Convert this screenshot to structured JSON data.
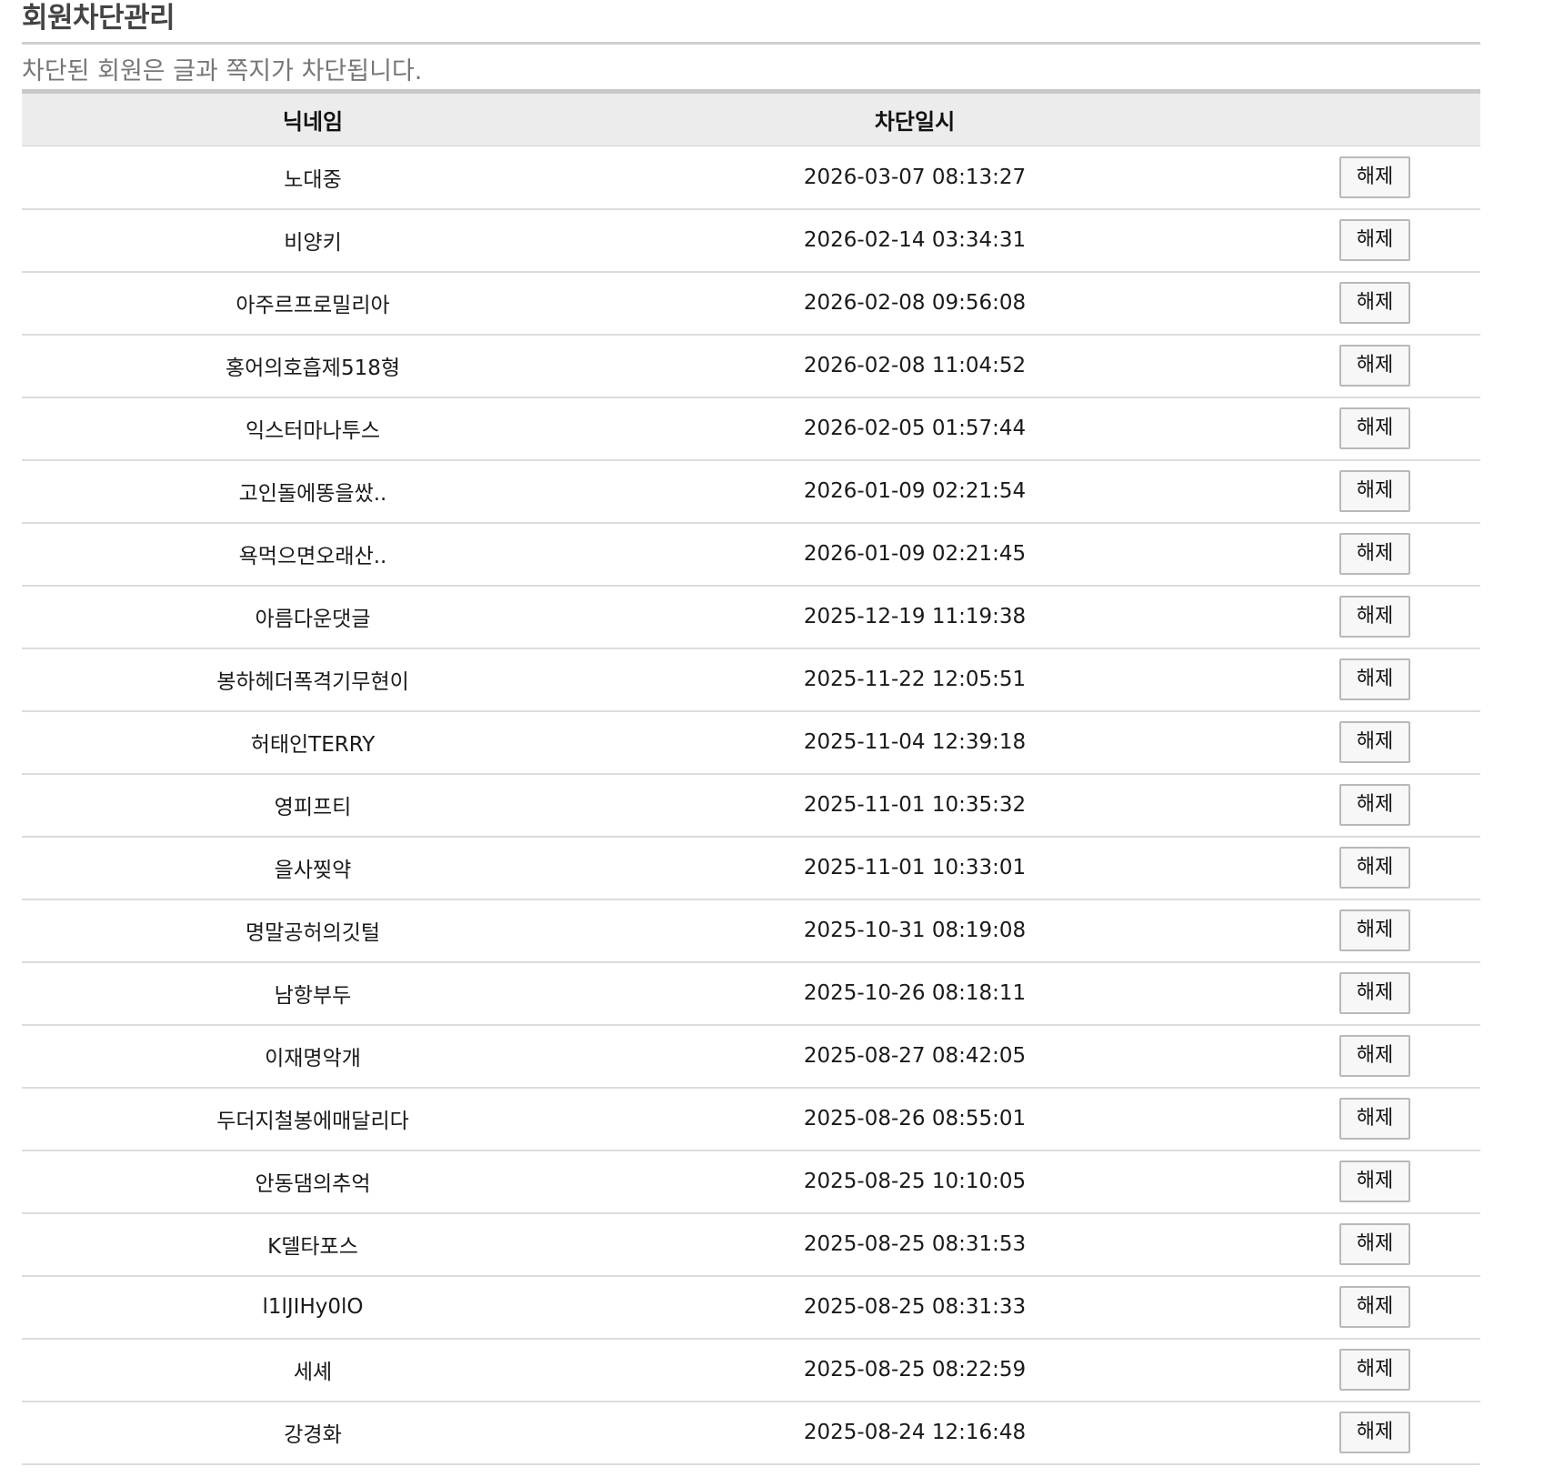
{
  "page": {
    "title": "회원차단관리",
    "notice": "차단된 회원은 글과 쪽지가 차단됩니다."
  },
  "table": {
    "columns": [
      "닉네임",
      "차단일시",
      ""
    ],
    "action_label": "해제",
    "rows": [
      {
        "nickname": "노대중",
        "blocked_at": "2026-03-07 08:13:27"
      },
      {
        "nickname": "비양키",
        "blocked_at": "2026-02-14 03:34:31"
      },
      {
        "nickname": "아주르프로밀리아",
        "blocked_at": "2026-02-08 09:56:08"
      },
      {
        "nickname": "홍어의호흡제518형",
        "blocked_at": "2026-02-08 11:04:52"
      },
      {
        "nickname": "익스터마나투스",
        "blocked_at": "2026-02-05 01:57:44"
      },
      {
        "nickname": "고인돌에똥을쌌..",
        "blocked_at": "2026-01-09 02:21:54"
      },
      {
        "nickname": "욕먹으면오래산..",
        "blocked_at": "2026-01-09 02:21:45"
      },
      {
        "nickname": "아름다운댓글",
        "blocked_at": "2025-12-19 11:19:38"
      },
      {
        "nickname": "봉하헤더폭격기무현이",
        "blocked_at": "2025-11-22 12:05:51"
      },
      {
        "nickname": "허태인TERRY",
        "blocked_at": "2025-11-04 12:39:18"
      },
      {
        "nickname": "영피프티",
        "blocked_at": "2025-11-01 10:35:32"
      },
      {
        "nickname": "을사찢약",
        "blocked_at": "2025-11-01 10:33:01"
      },
      {
        "nickname": "명말공허의깃털",
        "blocked_at": "2025-10-31 08:19:08"
      },
      {
        "nickname": "남항부두",
        "blocked_at": "2025-10-26 08:18:11"
      },
      {
        "nickname": "이재명악개",
        "blocked_at": "2025-08-27 08:42:05"
      },
      {
        "nickname": "두더지철봉에매달리다",
        "blocked_at": "2025-08-26 08:55:01"
      },
      {
        "nickname": "안동댐의추억",
        "blocked_at": "2025-08-25 10:10:05"
      },
      {
        "nickname": "K델타포스",
        "blocked_at": "2025-08-25 08:31:53"
      },
      {
        "nickname": "l1lJIHy0lO",
        "blocked_at": "2025-08-25 08:31:33"
      },
      {
        "nickname": "세셰",
        "blocked_at": "2025-08-25 08:22:59"
      },
      {
        "nickname": "강경화",
        "blocked_at": "2025-08-24 12:16:48"
      }
    ]
  }
}
